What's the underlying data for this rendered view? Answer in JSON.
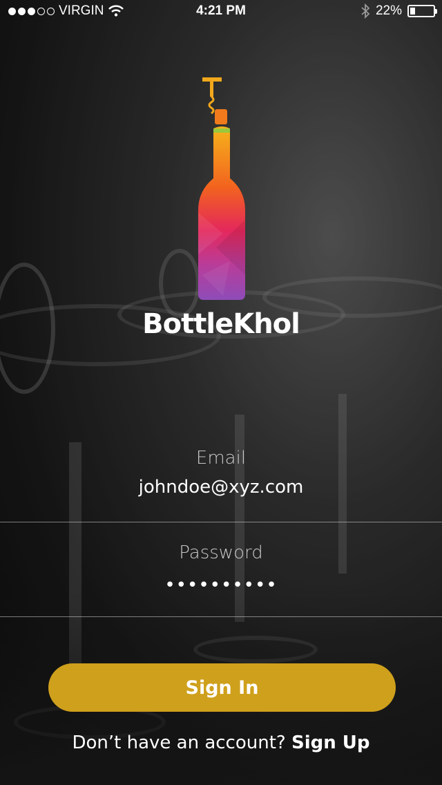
{
  "status_bar": {
    "carrier": "VIRGIN",
    "signal_dots_filled": 3,
    "signal_dots_total": 5,
    "time": "4:21 PM",
    "battery_percent": "22%",
    "battery_level": 0.22,
    "icons": [
      "wifi-icon",
      "bluetooth-icon",
      "battery-icon"
    ]
  },
  "brand": {
    "name": "BottleKhol",
    "logo_icon": "wine-bottle-corkscrew-logo"
  },
  "form": {
    "email_label": "Email",
    "email_value": "johndoe@xyz.com",
    "password_label": "Password",
    "password_value": "••••••••••"
  },
  "actions": {
    "sign_in_label": "Sign In",
    "footer_prompt": "Don’t have an account?",
    "sign_up_label": "Sign Up"
  },
  "colors": {
    "accent": "#cfa01c",
    "text": "#ffffff",
    "label": "#c8c8c8"
  }
}
